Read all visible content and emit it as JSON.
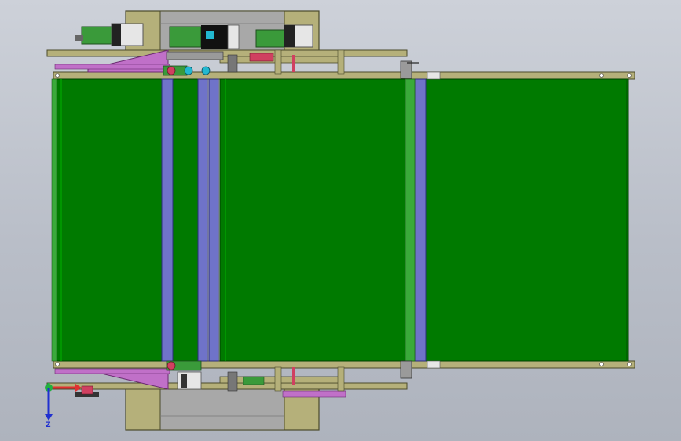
{
  "viewport": {
    "background_top": "#cdd1d9",
    "background_bottom": "#aeb3bd"
  },
  "colors": {
    "belt_green": "#007a00",
    "belt_green_dark": "#005f00",
    "frame_olive": "#b5b07a",
    "frame_edge": "#4a4a2a",
    "roller_blue": "#6f73c9",
    "bracket_magenta": "#c070c8",
    "housing_gray": "#a8a8a8",
    "motor_green": "#3a9a3a",
    "motor_silver": "#e6e6e6",
    "accent_cyan": "#22b8d0",
    "accent_red": "#d04060"
  },
  "triad": {
    "x_axis_color": "#e03030",
    "y_axis_color": "#20b040",
    "z_axis_color": "#2030d0",
    "z_label": "Z"
  }
}
